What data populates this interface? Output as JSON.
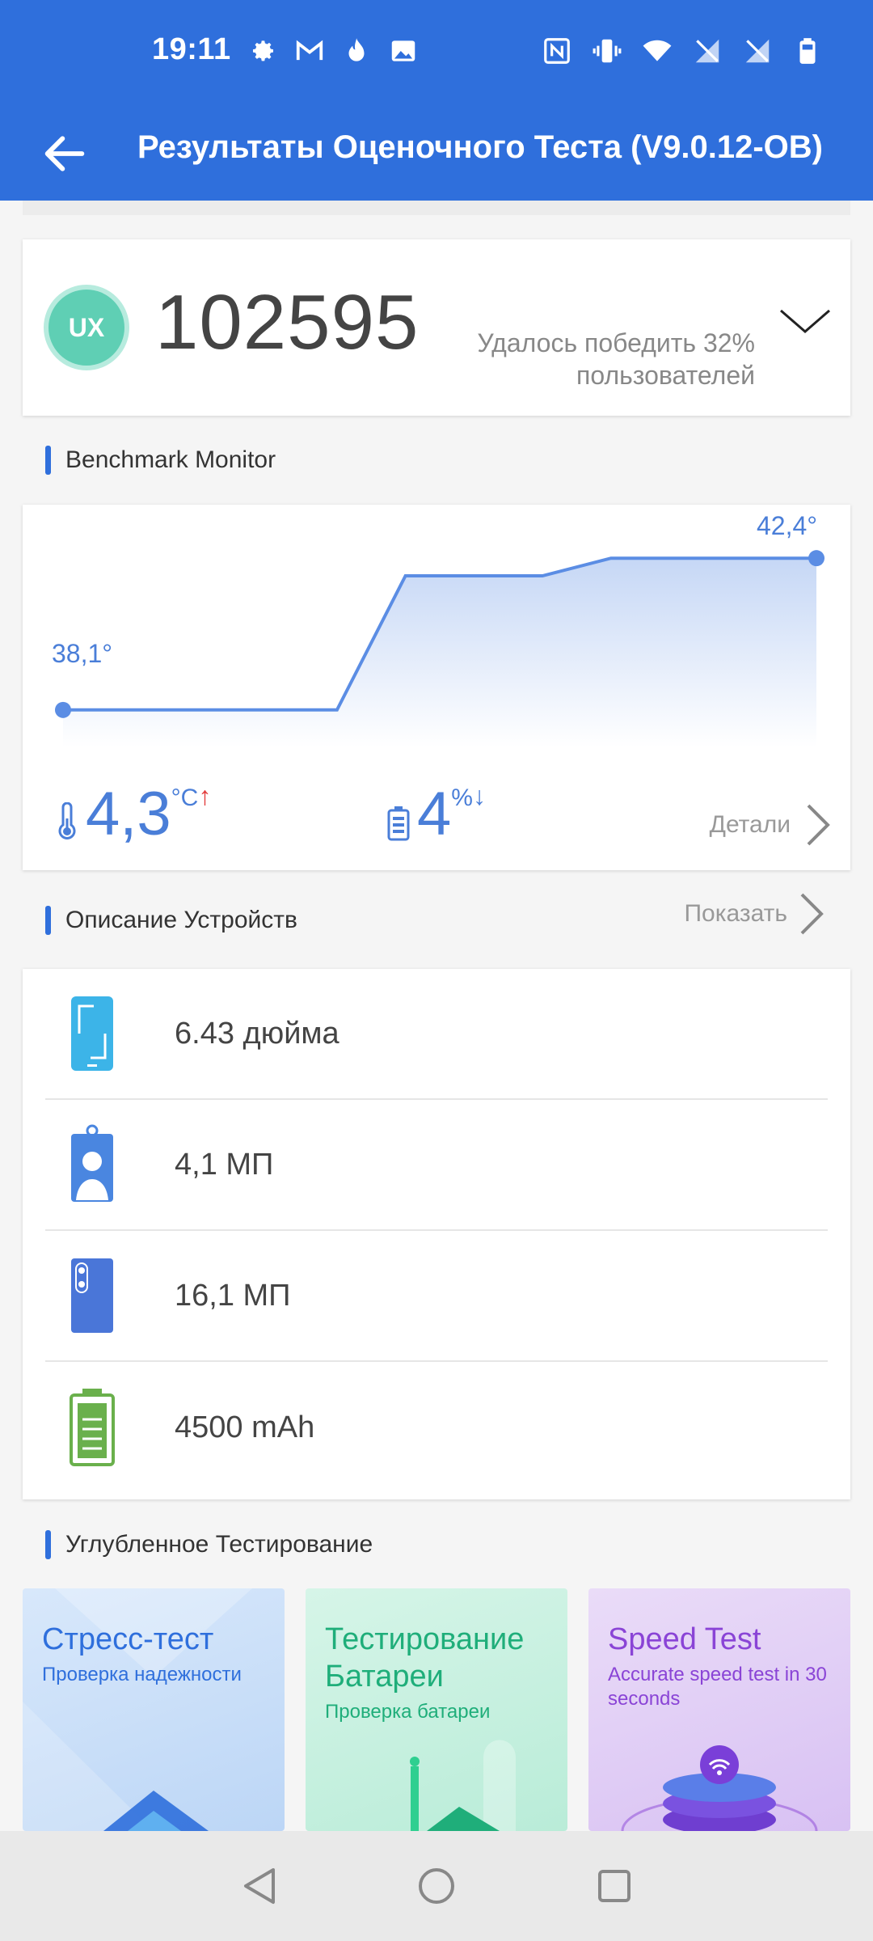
{
  "status_bar": {
    "time": "19:11",
    "left_icons": [
      "settings-icon",
      "gmail-icon",
      "flame-icon",
      "image-icon"
    ],
    "right_icons": [
      "nfc-icon",
      "vibrate-icon",
      "wifi-icon",
      "no-signal-icon",
      "no-signal-icon",
      "battery-icon"
    ]
  },
  "app_bar": {
    "title": "Результаты Оценочного Теста (V9.0.12-OB)",
    "back_icon": "arrow-left-icon"
  },
  "score": {
    "badge": "UX",
    "value": "102595",
    "beat_text": "Удалось победить 32% пользователей"
  },
  "monitor": {
    "section_title": "Benchmark Monitor",
    "temp_start": "38,1°",
    "temp_end": "42,4°",
    "temp_delta": "4,3",
    "temp_unit": "°C",
    "battery_delta": "4",
    "battery_unit": "%",
    "details_label": "Детали",
    "chart_data": {
      "type": "area",
      "points": [
        38.1,
        38.1,
        38.1,
        38.1,
        38.1,
        41.9,
        41.9,
        41.9,
        42.4,
        42.4,
        42.4,
        42.4
      ],
      "ylim": [
        37.5,
        43
      ]
    }
  },
  "device": {
    "section_title": "Описание Устройств",
    "show_label": "Показать",
    "rows": [
      {
        "icon": "phone-screen-icon",
        "value": "6.43 дюйма",
        "color": "#3cb4e8"
      },
      {
        "icon": "front-camera-icon",
        "value": "4,1 МП",
        "color": "#4a86e0"
      },
      {
        "icon": "rear-camera-icon",
        "value": "16,1 МП",
        "color": "#4a76d8"
      },
      {
        "icon": "battery-capacity-icon",
        "value": "4500 mAh",
        "color": "#6ab04c"
      }
    ]
  },
  "deep_testing": {
    "section_title": "Углубленное Тестирование",
    "cards": [
      {
        "title": "Стресс-тест",
        "subtitle": "Проверка надежности"
      },
      {
        "title": "Тестирование Батареи",
        "subtitle": "Проверка батареи"
      },
      {
        "title": "Speed Test",
        "subtitle": "Accurate speed test in 30 seconds"
      }
    ]
  },
  "nav": {
    "back": "triangle-back-icon",
    "home": "circle-home-icon",
    "recents": "square-recents-icon"
  }
}
